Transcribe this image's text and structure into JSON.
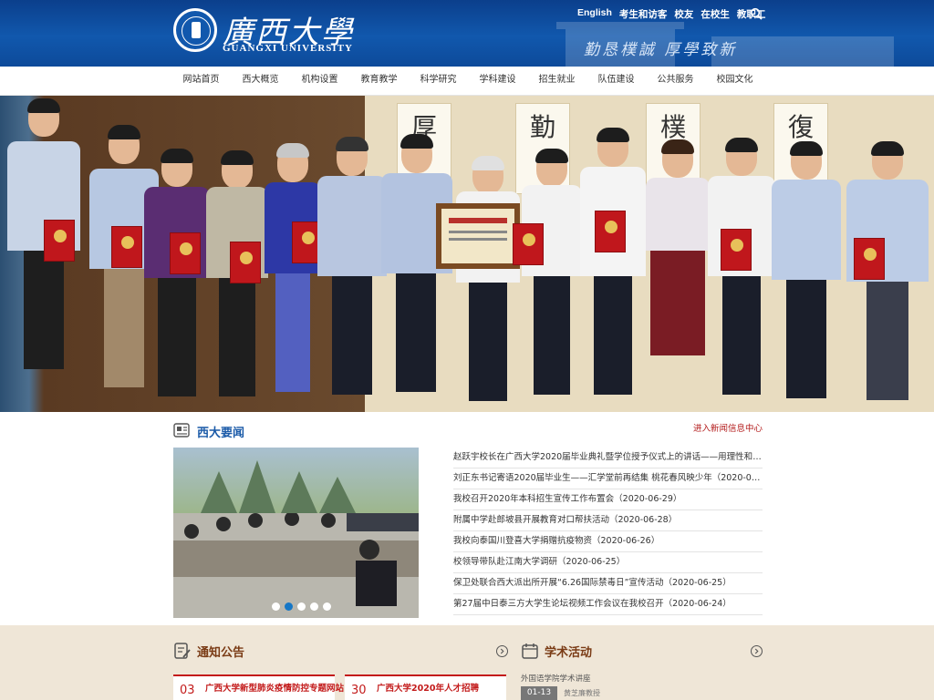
{
  "header": {
    "logo_cn": "廣西大學",
    "logo_en": "GUANGXI UNIVERSITY",
    "slogan": "勤恳樸誠 厚學致新",
    "top_links": [
      "English",
      "考生和访客",
      "校友",
      "在校生",
      "教职工"
    ]
  },
  "nav": {
    "items": [
      "网站首页",
      "西大概览",
      "机构设置",
      "教育教学",
      "科学研究",
      "学科建设",
      "招生就业",
      "队伍建设",
      "公共服务",
      "校园文化"
    ]
  },
  "banner": {
    "scroll_chars": [
      "厚",
      "勤",
      "樸",
      "復"
    ],
    "slide_count": 4,
    "active_slide": 2
  },
  "news": {
    "title": "西大要闻",
    "more_link": "进入新闻信息中心",
    "image_slide_count": 5,
    "image_active_slide": 2,
    "items": [
      "赵跃宇校长在广西大学2020届毕业典礼暨学位授予仪式上的讲话——用理性和担当的光...",
      "刘正东书记寄语2020届毕业生——汇学堂前再结集 桃花春风映少年（2020-06-22）",
      "我校召开2020年本科招生宣传工作布置会（2020-06-29）",
      "附属中学赴郎坡县开展教育对口帮扶活动（2020-06-28）",
      "我校向泰国川登喜大学捐赠抗疫物资（2020-06-26）",
      "校领导带队赴江南大学调研（2020-06-25）",
      "保卫处联合西大派出所开展“6.26国际禁毒日”宣传活动（2020-06-25）",
      "第27届中日泰三方大学生论坛视频工作会议在我校召开（2020-06-24）"
    ]
  },
  "notice": {
    "title": "通知公告",
    "cards": [
      {
        "num": "03",
        "text": "广西大学新型肺炎疫情防控专题网站"
      },
      {
        "num": "30",
        "text": "广西大学2020年人才招聘"
      }
    ]
  },
  "activity": {
    "title": "学术活动",
    "item_title": "外国语学院学术讲座",
    "item_date": "01-13",
    "item_sub": "黄芝廉教授"
  },
  "colors": {
    "header_blue": "#1158ad",
    "accent_red": "#c31b1b",
    "news_blue": "#1a5aa8",
    "section_bg": "#efe6d7"
  }
}
